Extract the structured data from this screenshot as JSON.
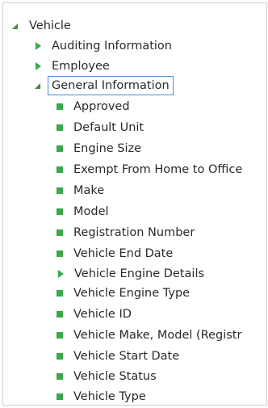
{
  "tree": {
    "root": {
      "label": "Vehicle"
    },
    "children": [
      {
        "label": "Auditing Information"
      },
      {
        "label": "Employee"
      },
      {
        "label": "General Information",
        "selected": true
      }
    ],
    "general_items": [
      {
        "label": "Approved"
      },
      {
        "label": "Default Unit"
      },
      {
        "label": "Engine Size"
      },
      {
        "label": "Exempt From Home to Office"
      },
      {
        "label": "Make"
      },
      {
        "label": "Model"
      },
      {
        "label": "Registration Number"
      },
      {
        "label": "Vehicle End Date"
      },
      {
        "label": "Vehicle Engine Details"
      },
      {
        "label": "Vehicle Engine Type"
      },
      {
        "label": "Vehicle ID"
      },
      {
        "label": "Vehicle Make, Model (Registr"
      },
      {
        "label": "Vehicle Start Date"
      },
      {
        "label": "Vehicle Status"
      },
      {
        "label": "Vehicle Type"
      }
    ]
  },
  "colors": {
    "leaf": "#3aa84b",
    "expander": "#3aa84b",
    "collapser": "#4a8a3c",
    "selection_border": "#4a90d9"
  }
}
